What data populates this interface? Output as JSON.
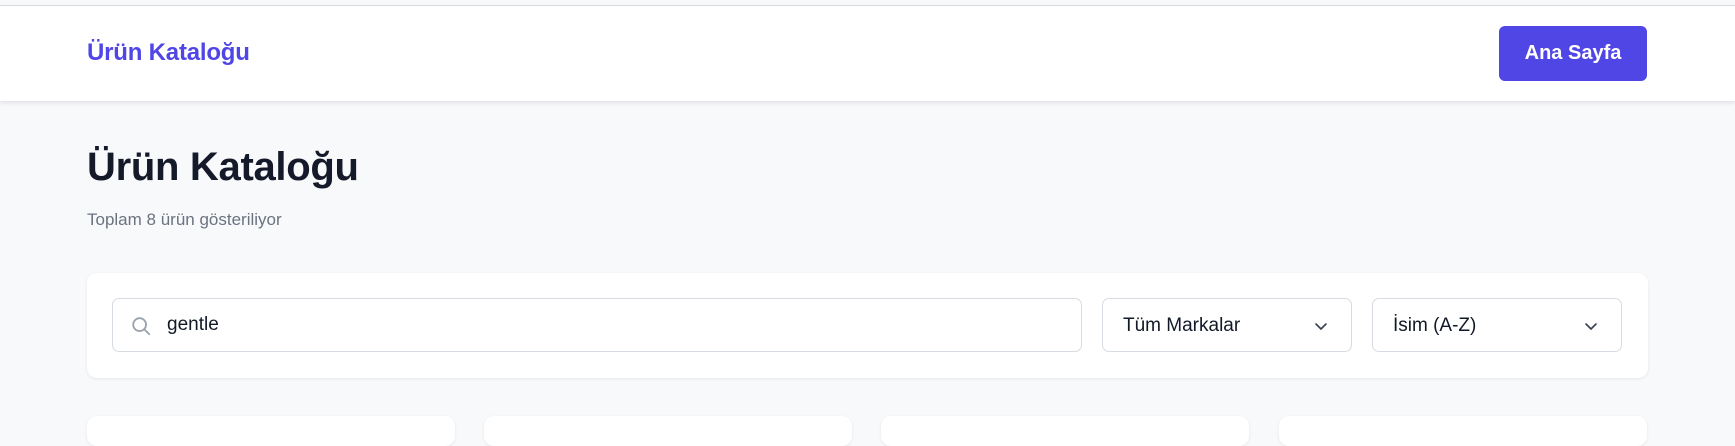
{
  "navbar": {
    "brand": "Ürün Kataloğu",
    "home_button": "Ana Sayfa"
  },
  "page": {
    "title": "Ürün Kataloğu",
    "subtitle": "Toplam 8 ürün gösteriliyor"
  },
  "filters": {
    "search": {
      "value": "gentle",
      "icon": "search-icon"
    },
    "brand_select": {
      "selected": "Tüm Markalar",
      "icon": "chevron-down-icon"
    },
    "sort_select": {
      "selected": "İsim (A-Z)",
      "icon": "chevron-down-icon"
    }
  },
  "colors": {
    "accent": "#4f46e5",
    "background": "#f8f9fb",
    "title": "#141a2a",
    "muted": "#6b7280"
  }
}
